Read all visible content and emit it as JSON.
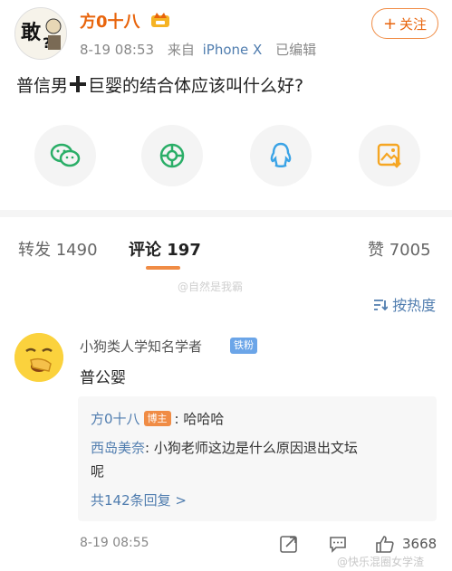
{
  "post": {
    "author_name": "方0十八",
    "timestamp": "8-19 08:53",
    "source_prefix": "来自",
    "device": "iPhone X",
    "edited_label": "已编辑",
    "follow_label": "关注",
    "text_before": "普信男",
    "text_after": "巨婴的结合体应该叫什么好?"
  },
  "share_buttons": [
    {
      "icon": "wechat-icon",
      "color": "#2aae67"
    },
    {
      "icon": "moments-icon",
      "color": "#2aae67"
    },
    {
      "icon": "qq-icon",
      "color": "#3aa3e6"
    },
    {
      "icon": "save-image-icon",
      "color": "#f5a623"
    }
  ],
  "tabs": {
    "repost": "转发 1490",
    "comments": "评论 197",
    "likes": "赞 7005"
  },
  "watermark_top": "@自然是我霸",
  "sort_label": "按热度",
  "comment": {
    "author": "小狗类人学知名学者",
    "badge": "铁粉",
    "text": "普公婴",
    "replies": [
      {
        "name": "方0十八",
        "badge": "博主",
        "text": ": 哈哈哈"
      },
      {
        "name": "西岛美奈",
        "text": ": 小狗老师这边是什么原因退出文坛",
        "text_cont": "呢"
      }
    ],
    "more_replies": "共142条回复 >",
    "timestamp": "8-19 08:55",
    "like_count": "3668"
  },
  "watermark_bottom": "@快乐混圈女学渣",
  "colors": {
    "brand_orange": "#e8640c",
    "link_blue": "#507daf",
    "fan_badge": "#6ba5e8"
  }
}
